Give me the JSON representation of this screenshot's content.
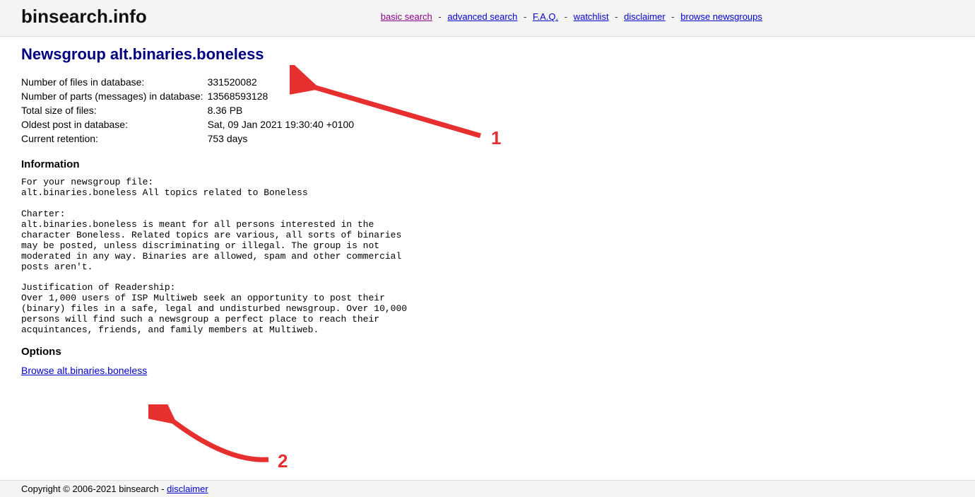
{
  "header": {
    "site_title": "binsearch.info",
    "nav": {
      "basic_search": "basic search",
      "advanced_search": "advanced search",
      "faq": "F.A.Q.",
      "watchlist": "watchlist",
      "disclaimer": "disclaimer",
      "browse_newsgroups": "browse newsgroups",
      "separator": "-"
    }
  },
  "page": {
    "title": "Newsgroup alt.binaries.boneless",
    "stats": {
      "num_files_label": "Number of files in database:",
      "num_files_value": "331520082",
      "num_parts_label": "Number of parts (messages) in database:",
      "num_parts_value": "13568593128",
      "total_size_label": "Total size of files:",
      "total_size_value": "8.36 PB",
      "oldest_post_label": "Oldest post in database:",
      "oldest_post_value": "Sat, 09 Jan 2021 19:30:40 +0100",
      "retention_label": "Current retention:",
      "retention_value": "753 days"
    },
    "information_heading": "Information",
    "information_text": "For your newsgroup file:\nalt.binaries.boneless All topics related to Boneless\n\nCharter:\nalt.binaries.boneless is meant for all persons interested in the\ncharacter Boneless. Related topics are various, all sorts of binaries\nmay be posted, unless discriminating or illegal. The group is not\nmoderated in any way. Binaries are allowed, spam and other commercial\nposts aren't.\n\nJustification of Readership:\nOver 1,000 users of ISP Multiweb seek an opportunity to post their\n(binary) files in a safe, legal and undisturbed newsgroup. Over 10,000\npersons will find such a newsgroup a perfect place to reach their\nacquintances, friends, and family members at Multiweb.",
    "options_heading": "Options",
    "browse_link": "Browse alt.binaries.boneless"
  },
  "footer": {
    "copyright": "Copyright © 2006-2021 binsearch - ",
    "disclaimer": "disclaimer"
  },
  "annotations": {
    "one": "1",
    "two": "2"
  }
}
